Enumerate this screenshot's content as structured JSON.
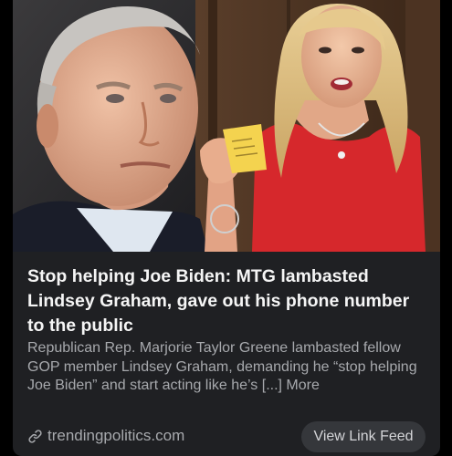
{
  "article": {
    "title": "Stop helping Joe Biden: MTG lambasted Lindsey Graham, gave out his phone number to the public",
    "description": "Republican Rep. Marjorie Taylor Greene lambasted fellow GOP member Lindsey Graham, demanding he “stop helping Joe Biden” and start acting like he’s [...] More",
    "source": "trendingpolitics.com",
    "source_icon": "link-icon"
  },
  "actions": {
    "view_link_feed_label": "View Link Feed"
  },
  "colors": {
    "card_background": "#1f2023",
    "title_text": "#f5f5f5",
    "body_text": "#a7a9ad",
    "button_background": "#35373b"
  }
}
